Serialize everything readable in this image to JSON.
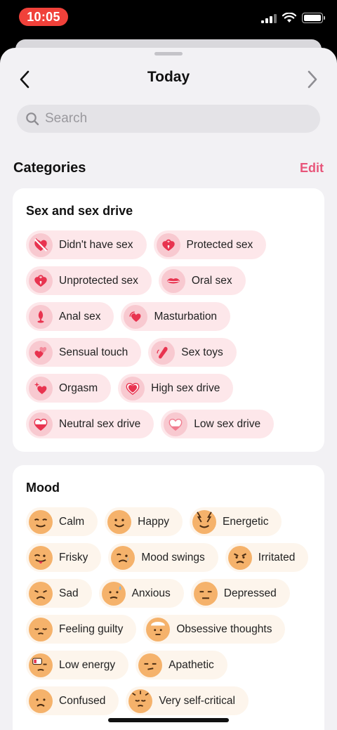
{
  "status": {
    "time": "10:05"
  },
  "nav": {
    "title": "Today"
  },
  "search": {
    "placeholder": "Search"
  },
  "categories": {
    "title": "Categories",
    "edit": "Edit"
  },
  "colors": {
    "accent": "#e8557a",
    "heart": "#e8334f",
    "face": "#f5b26b"
  },
  "sex_section": {
    "title": "Sex and sex drive",
    "items": [
      {
        "label": "Didn't have sex",
        "icon": "crossed-heart-icon"
      },
      {
        "label": "Protected sex",
        "icon": "heart-lock-icon"
      },
      {
        "label": "Unprotected sex",
        "icon": "open-heart-lock-icon"
      },
      {
        "label": "Oral sex",
        "icon": "lips-icon"
      },
      {
        "label": "Anal sex",
        "icon": "plug-icon"
      },
      {
        "label": "Masturbation",
        "icon": "heart-waves-icon"
      },
      {
        "label": "Sensual touch",
        "icon": "hand-heart-icon"
      },
      {
        "label": "Sex toys",
        "icon": "vibrator-icon"
      },
      {
        "label": "Orgasm",
        "icon": "sparkle-heart-icon"
      },
      {
        "label": "High sex drive",
        "icon": "full-heart-icon"
      },
      {
        "label": "Neutral sex drive",
        "icon": "half-heart-icon"
      },
      {
        "label": "Low sex drive",
        "icon": "low-heart-icon"
      }
    ]
  },
  "mood_section": {
    "title": "Mood",
    "items": [
      {
        "label": "Calm",
        "icon": "calm-face-icon"
      },
      {
        "label": "Happy",
        "icon": "happy-face-icon"
      },
      {
        "label": "Energetic",
        "icon": "energetic-face-icon"
      },
      {
        "label": "Frisky",
        "icon": "frisky-face-icon"
      },
      {
        "label": "Mood swings",
        "icon": "mood-swings-face-icon"
      },
      {
        "label": "Irritated",
        "icon": "irritated-face-icon"
      },
      {
        "label": "Sad",
        "icon": "sad-face-icon"
      },
      {
        "label": "Anxious",
        "icon": "anxious-face-icon"
      },
      {
        "label": "Depressed",
        "icon": "depressed-face-icon"
      },
      {
        "label": "Feeling guilty",
        "icon": "guilty-face-icon"
      },
      {
        "label": "Obsessive thoughts",
        "icon": "obsessive-face-icon"
      },
      {
        "label": "Low energy",
        "icon": "low-energy-face-icon"
      },
      {
        "label": "Apathetic",
        "icon": "apathetic-face-icon"
      },
      {
        "label": "Confused",
        "icon": "confused-face-icon"
      },
      {
        "label": "Very self-critical",
        "icon": "self-critical-face-icon"
      }
    ]
  }
}
